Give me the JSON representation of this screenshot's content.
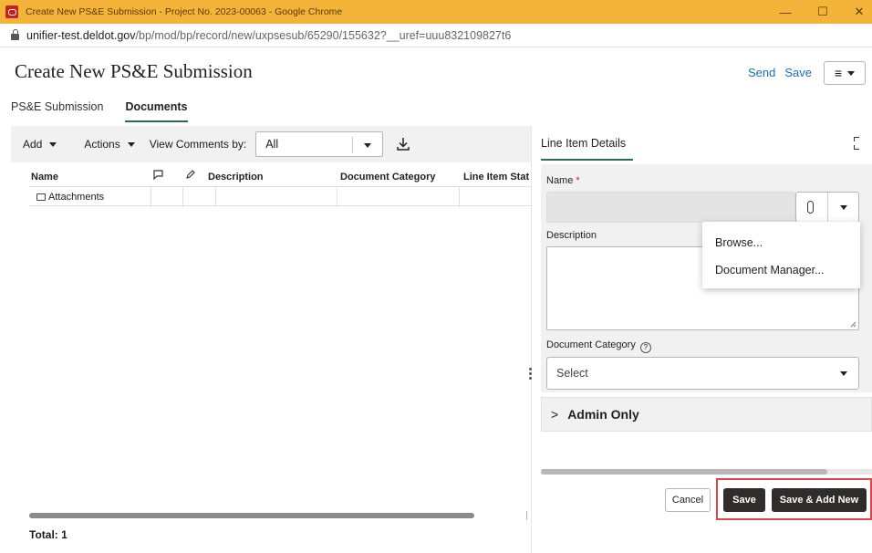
{
  "browser": {
    "window_title": "Create New PS&E Submission - Project No. 2023-00063 - Google Chrome",
    "url_host": "unifier-test.deldot.gov",
    "url_path": "/bp/mod/bp/record/new/uxpsesub/65290/155632?__uref=uuu832109827t6",
    "controls": {
      "minimize": "—",
      "maximize": "☐",
      "close": "✕"
    }
  },
  "header": {
    "title": "Create New PS&E Submission",
    "actions": [
      "Send",
      "Save"
    ],
    "menu_icon": "≡"
  },
  "tabs": [
    {
      "label": "PS&E Submission",
      "active": false
    },
    {
      "label": "Documents",
      "active": true
    }
  ],
  "left": {
    "toolbar": {
      "add_label": "Add",
      "actions_label": "Actions",
      "view_comments_label": "View Comments by:",
      "view_comments_value": "All",
      "download_icon": "download-icon"
    },
    "columns": {
      "name": "Name",
      "comment_icon": "comment-icon",
      "edit_icon": "edit-icon",
      "description": "Description",
      "category": "Document Category",
      "status": "Line Item Stat"
    },
    "rows": [
      {
        "name": "Attachments"
      }
    ],
    "total": "Total: 1"
  },
  "right": {
    "title": "Line Item Details",
    "name_label": "Name",
    "required_mark": "*",
    "description_label": "Description",
    "category_label": "Document Category",
    "category_help": "?",
    "category_value": "Select",
    "admin_label": "Admin Only",
    "admin_chevron": ">",
    "attach_menu": [
      "Browse...",
      "Document Manager..."
    ],
    "buttons": {
      "cancel": "Cancel",
      "save": "Save",
      "save_add_new": "Save & Add New"
    }
  }
}
